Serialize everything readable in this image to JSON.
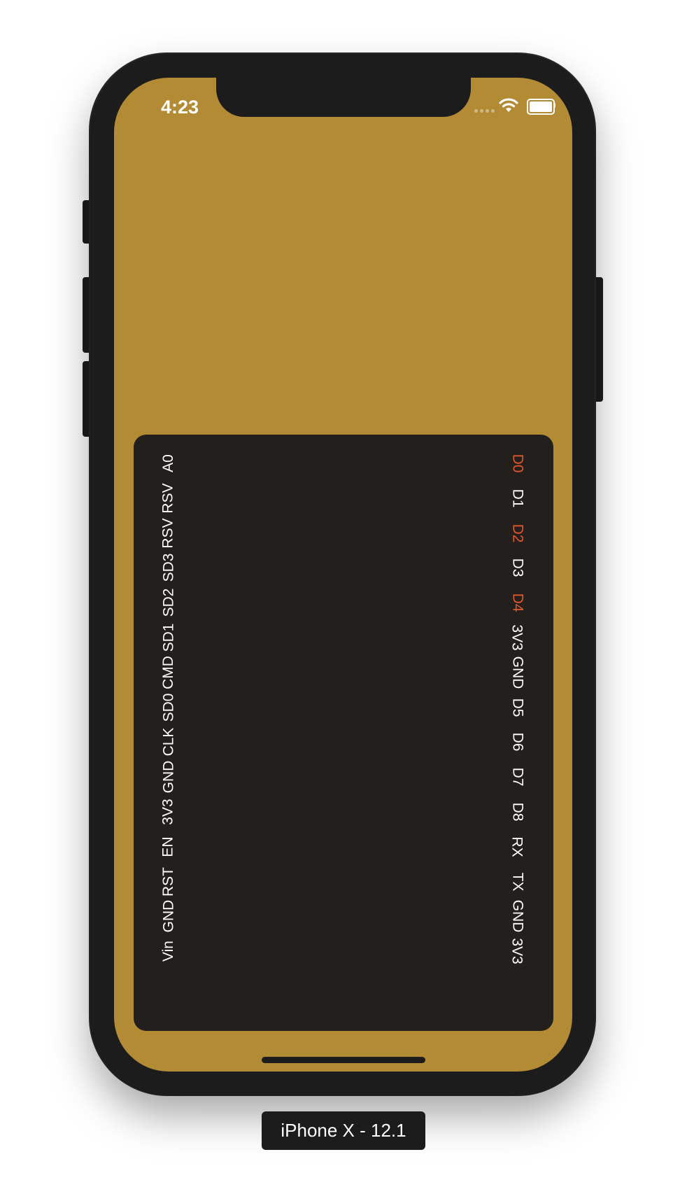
{
  "status_bar": {
    "time": "4:23",
    "wifi_icon": "wifi-icon",
    "battery_icon": "battery-full-icon"
  },
  "colors": {
    "screen_background": "#b38b35",
    "board_background": "#231f1d",
    "pin_default": "#ffffff",
    "pin_active": "#e0582b"
  },
  "board": {
    "left_pins": [
      {
        "label": "A0",
        "active": false
      },
      {
        "label": "RSV",
        "active": false
      },
      {
        "label": "RSV",
        "active": false
      },
      {
        "label": "SD3",
        "active": false
      },
      {
        "label": "SD2",
        "active": false
      },
      {
        "label": "SD1",
        "active": false
      },
      {
        "label": "CMD",
        "active": false
      },
      {
        "label": "SD0",
        "active": false
      },
      {
        "label": "CLK",
        "active": false
      },
      {
        "label": "GND",
        "active": false
      },
      {
        "label": "3V3",
        "active": false
      },
      {
        "label": "EN",
        "active": false
      },
      {
        "label": "RST",
        "active": false
      },
      {
        "label": "GND",
        "active": false
      },
      {
        "label": "Vin",
        "active": false
      }
    ],
    "right_pins": [
      {
        "label": "D0",
        "active": true
      },
      {
        "label": "D1",
        "active": false
      },
      {
        "label": "D2",
        "active": true
      },
      {
        "label": "D3",
        "active": false
      },
      {
        "label": "D4",
        "active": true
      },
      {
        "label": "3V3",
        "active": false
      },
      {
        "label": "GND",
        "active": false
      },
      {
        "label": "D5",
        "active": false
      },
      {
        "label": "D6",
        "active": false
      },
      {
        "label": "D7",
        "active": false
      },
      {
        "label": "D8",
        "active": false
      },
      {
        "label": "RX",
        "active": false
      },
      {
        "label": "TX",
        "active": false
      },
      {
        "label": "GND",
        "active": false
      },
      {
        "label": "3V3",
        "active": false
      }
    ]
  },
  "simulator": {
    "device_label": "iPhone X - 12.1"
  }
}
